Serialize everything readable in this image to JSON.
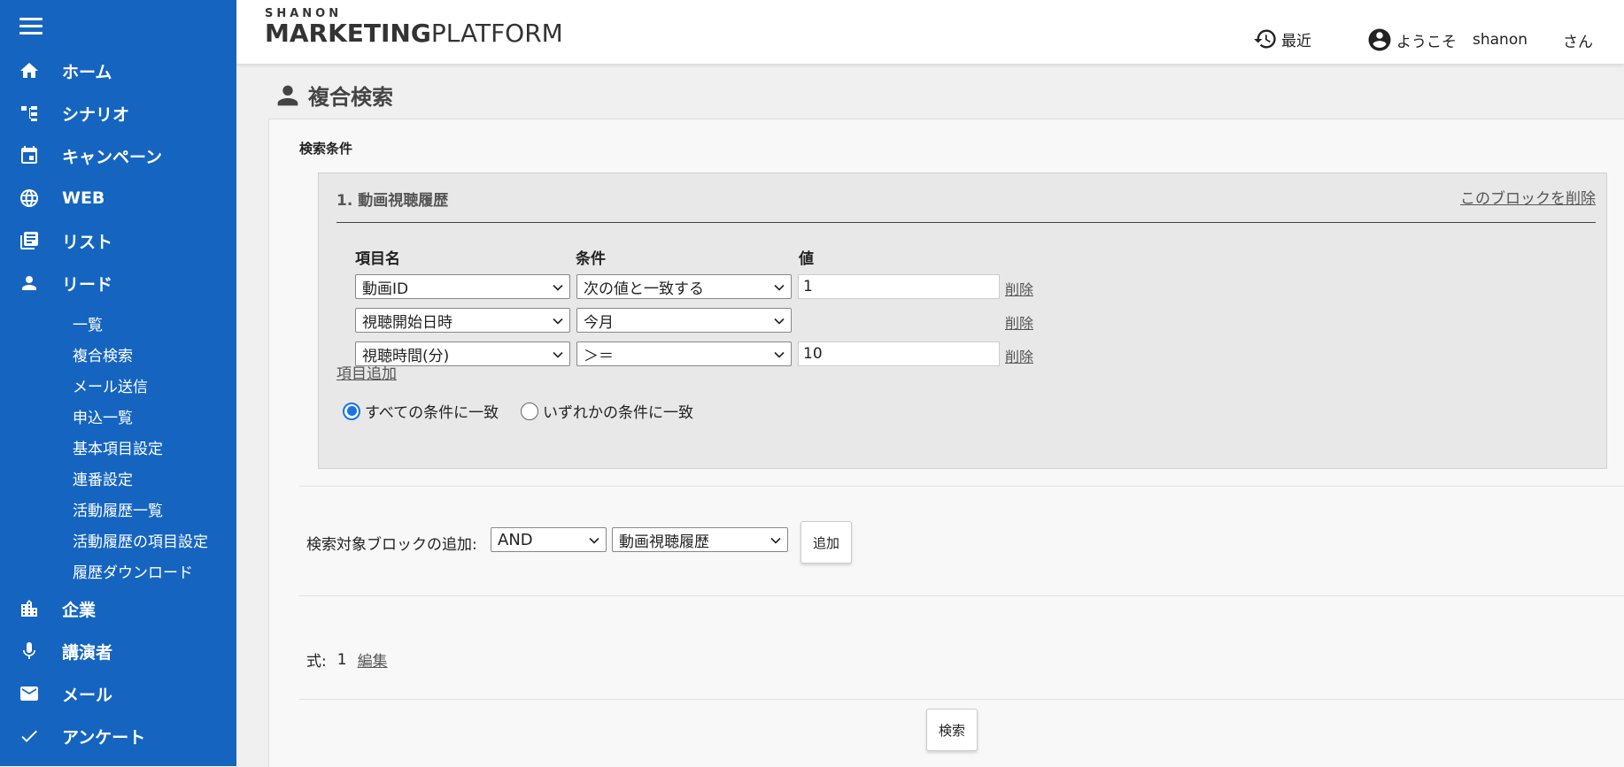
{
  "sidebar": {
    "items": [
      {
        "label": "ホーム",
        "icon": "home-icon"
      },
      {
        "label": "シナリオ",
        "icon": "scenario-icon"
      },
      {
        "label": "キャンペーン",
        "icon": "calendar-icon"
      },
      {
        "label": "WEB",
        "icon": "globe-icon"
      },
      {
        "label": "リスト",
        "icon": "list-icon"
      },
      {
        "label": "リード",
        "icon": "person-icon"
      },
      {
        "label": "企業",
        "icon": "building-icon"
      },
      {
        "label": "講演者",
        "icon": "microphone-icon"
      },
      {
        "label": "メール",
        "icon": "mail-icon"
      },
      {
        "label": "アンケート",
        "icon": "check-icon"
      }
    ],
    "lead_sub": [
      "一覧",
      "複合検索",
      "メール送信",
      "申込一覧",
      "基本項目設定",
      "連番設定",
      "活動履歴一覧",
      "活動履歴の項目設定",
      "履歴ダウンロード"
    ]
  },
  "header": {
    "logo_small": "SHANON",
    "logo_big_bold": "MARKETING",
    "logo_big_light": "PLATFORM",
    "recent": "最近",
    "welcome": "ようこそ",
    "user": "shanon",
    "suffix": "さん"
  },
  "page": {
    "title": "複合検索"
  },
  "search": {
    "section_label": "検索条件",
    "block": {
      "title": "1. 動画視聴履歴",
      "delete_label": "このブロックを削除",
      "headers": {
        "item": "項目名",
        "condition": "条件",
        "value": "値"
      },
      "rows": [
        {
          "item": "動画ID",
          "condition": "次の値と一致する",
          "value": "1",
          "delete": "削除"
        },
        {
          "item": "視聴開始日時",
          "condition": "今月",
          "value": "",
          "delete": "削除"
        },
        {
          "item": "視聴時間(分)",
          "condition": "＞＝",
          "value": "10",
          "delete": "削除"
        }
      ],
      "add_item": "項目追加",
      "radio_all": "すべての条件に一致",
      "radio_any": "いずれかの条件に一致"
    },
    "add_block": {
      "label": "検索対象ブロックの追加:",
      "operator": "AND",
      "target": "動画視聴履歴",
      "add_button": "追加"
    },
    "formula": {
      "label": "式:",
      "value": "1",
      "edit": "編集"
    },
    "search_button": "検索"
  },
  "colors": {
    "sidebar": "#1565c0",
    "radio_accent": "#1a73e8"
  }
}
